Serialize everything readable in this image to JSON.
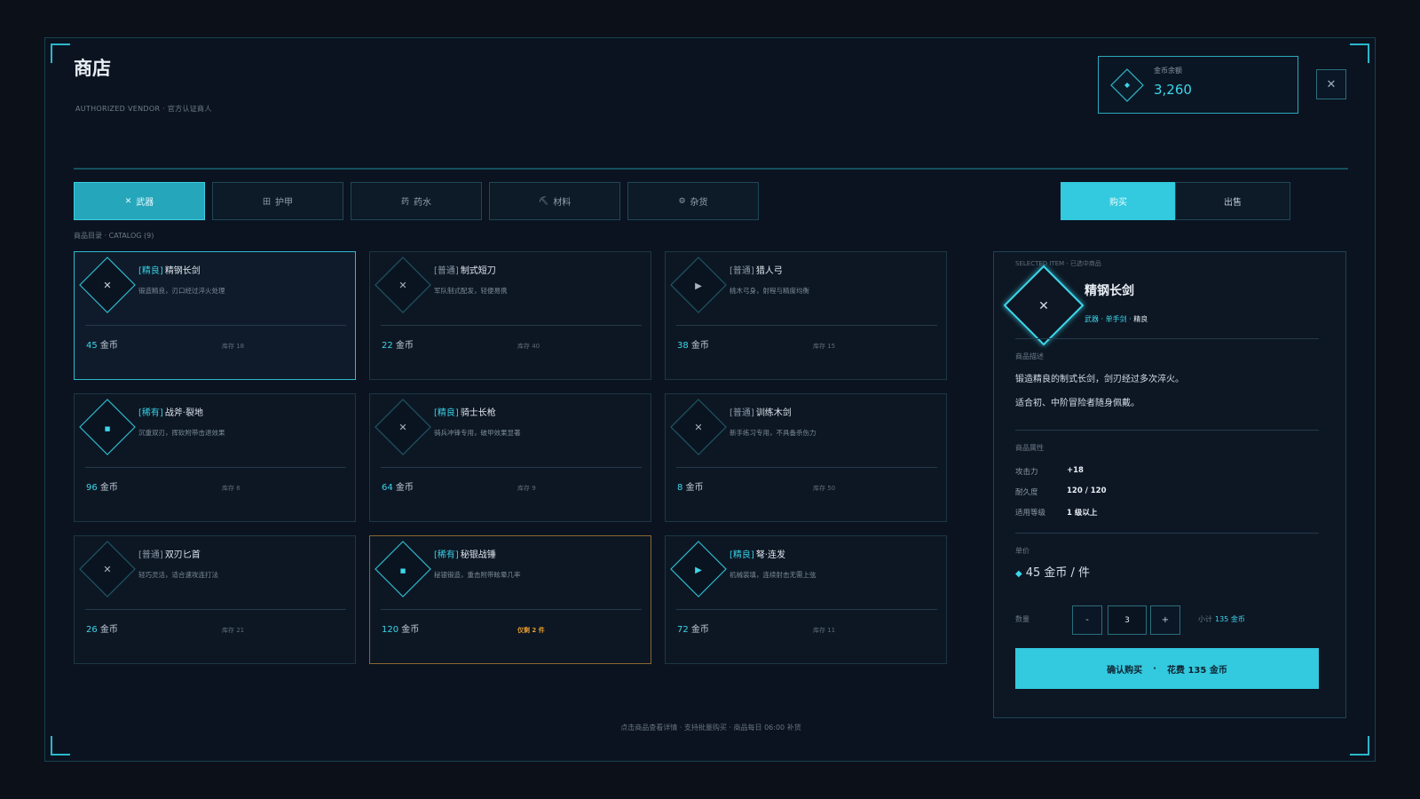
{
  "header": {
    "title": "商店",
    "subtitle": "AUTHORIZED VENDOR · 官方认证商人",
    "balance_label": "金币余额",
    "balance_value": "3,260",
    "close_label": "✕"
  },
  "tabs": [
    {
      "icon": "✕",
      "label": "武器",
      "active": true
    },
    {
      "icon": "田",
      "label": "护甲",
      "active": false
    },
    {
      "icon": "药",
      "label": "药水",
      "active": false
    },
    {
      "icon": "⛏",
      "label": "材料",
      "active": false
    },
    {
      "icon": "⚙",
      "label": "杂货",
      "active": false
    }
  ],
  "modes": {
    "buy": "购买",
    "sell": "出售"
  },
  "catalog_label": "商品目录 · CATALOG (9)",
  "currency": "金币",
  "items": [
    {
      "rarity": "[精良]",
      "name": "精钢长剑",
      "desc": "锻造精良，刃口经过淬火处理",
      "price": "45",
      "stock": "库存 18",
      "icon": "✕"
    },
    {
      "rarity": "[普通]",
      "name": "制式短刀",
      "desc": "军队制式配发，轻便易携",
      "price": "22",
      "stock": "库存 40",
      "icon": "✕"
    },
    {
      "rarity": "[普通]",
      "name": "猎人弓",
      "desc": "桃木弓身，射程与精度均衡",
      "price": "38",
      "stock": "库存 15",
      "icon": "▶"
    },
    {
      "rarity": "[稀有]",
      "name": "战斧·裂地",
      "desc": "沉重双刃，挥砍附带击退效果",
      "price": "96",
      "stock": "库存 6",
      "icon": "■"
    },
    {
      "rarity": "[精良]",
      "name": "骑士长枪",
      "desc": "骑兵冲锋专用，破甲效果显著",
      "price": "64",
      "stock": "库存 9",
      "icon": "✕"
    },
    {
      "rarity": "[普通]",
      "name": "训练木剑",
      "desc": "新手练习专用，不具备杀伤力",
      "price": "8",
      "stock": "库存 50",
      "icon": "✕"
    },
    {
      "rarity": "[普通]",
      "name": "双刃匕首",
      "desc": "轻巧灵活，适合速攻连打法",
      "price": "26",
      "stock": "库存 21",
      "icon": "✕"
    },
    {
      "rarity": "[稀有]",
      "name": "秘银战锤",
      "desc": "秘银锻造，重击附带眩晕几率",
      "price": "120",
      "stock": "仅剩 2 件",
      "icon": "■"
    },
    {
      "rarity": "[精良]",
      "name": "弩·连发",
      "desc": "机械装填，连续射击无需上弦",
      "price": "72",
      "stock": "库存 11",
      "icon": "▶"
    }
  ],
  "detail": {
    "selected_label": "SELECTED ITEM · 已选中商品",
    "icon": "✕",
    "name": "精钢长剑",
    "tag_type": "武器 · 单手剑 ·",
    "tag_rarity": "精良",
    "desc_label": "商品描述",
    "desc_lines": [
      "锻造精良的制式长剑，剑刃经过多次淬火。",
      "适合初、中阶冒险者随身佩戴。"
    ],
    "attr_label": "商品属性",
    "attributes": [
      {
        "key": "攻击力",
        "value": "+18"
      },
      {
        "key": "耐久度",
        "value": "120 / 120"
      },
      {
        "key": "适用等级",
        "value": "1 级以上"
      }
    ],
    "unit_price_label": "单价",
    "unit_price": "45 金币 / 件",
    "qty_label": "数量",
    "qty_minus": "-",
    "qty_value": "3",
    "qty_plus": "+",
    "subtotal_label": "小计",
    "subtotal_value": "135 金币",
    "confirm_label": "确认购买",
    "confirm_dot": "·",
    "confirm_cost": "花费 135 金币"
  },
  "footer": "点击商品查看详情 · 支持批量购买 · 商品每日 06:00 补货",
  "colors": {
    "accent": "#33c9de",
    "epic_border": "#8b6630",
    "warn": "#e39a2d",
    "panel": "#0d1724"
  }
}
